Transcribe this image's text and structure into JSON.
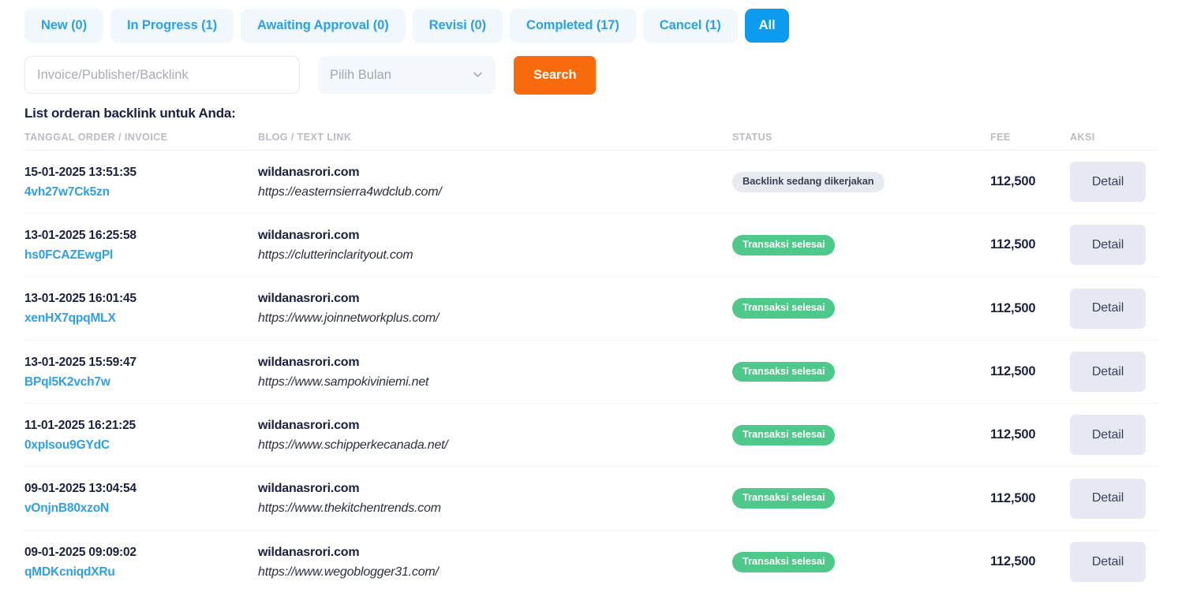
{
  "tabs": [
    {
      "label": "New (0)",
      "active": false,
      "name": "tab-new"
    },
    {
      "label": "In Progress (1)",
      "active": false,
      "name": "tab-in-progress"
    },
    {
      "label": "Awaiting Approval (0)",
      "active": false,
      "name": "tab-awaiting-approval"
    },
    {
      "label": "Revisi (0)",
      "active": false,
      "name": "tab-revisi"
    },
    {
      "label": "Completed (17)",
      "active": false,
      "name": "tab-completed"
    },
    {
      "label": "Cancel (1)",
      "active": false,
      "name": "tab-cancel"
    },
    {
      "label": "All",
      "active": true,
      "name": "tab-all"
    }
  ],
  "filters": {
    "search_placeholder": "Invoice/Publisher/Backlink",
    "search_value": "",
    "month_selected": "Pilih Bulan",
    "month_options": [
      "Pilih Bulan"
    ],
    "search_button": "Search"
  },
  "list_title": "List orderan backlink untuk Anda:",
  "table": {
    "headers": {
      "date": "TANGGAL ORDER / INVOICE",
      "blog": "BLOG / TEXT LINK",
      "status": "STATUS",
      "fee": "FEE",
      "aksi": "AKSI"
    },
    "detail_label": "Detail",
    "rows": [
      {
        "order_date": "15-01-2025 13:51:35",
        "invoice": "4vh27w7Ck5zn",
        "blog": "wildanasrori.com",
        "text_link": "https://easternsierra4wdclub.com/",
        "status": "Backlink sedang dikerjakan",
        "status_type": "progress",
        "fee": "112,500"
      },
      {
        "order_date": "13-01-2025 16:25:58",
        "invoice": "hs0FCAZEwgPl",
        "blog": "wildanasrori.com",
        "text_link": "https://clutterinclarityout.com",
        "status": "Transaksi selesai",
        "status_type": "done",
        "fee": "112,500"
      },
      {
        "order_date": "13-01-2025 16:01:45",
        "invoice": "xenHX7qpqMLX",
        "blog": "wildanasrori.com",
        "text_link": "https://www.joinnetworkplus.com/",
        "status": "Transaksi selesai",
        "status_type": "done",
        "fee": "112,500"
      },
      {
        "order_date": "13-01-2025 15:59:47",
        "invoice": "BPql5K2vch7w",
        "blog": "wildanasrori.com",
        "text_link": "https://www.sampokiviniemi.net",
        "status": "Transaksi selesai",
        "status_type": "done",
        "fee": "112,500"
      },
      {
        "order_date": "11-01-2025 16:21:25",
        "invoice": "0xpIsou9GYdC",
        "blog": "wildanasrori.com",
        "text_link": "https://www.schipperkecanada.net/",
        "status": "Transaksi selesai",
        "status_type": "done",
        "fee": "112,500"
      },
      {
        "order_date": "09-01-2025 13:04:54",
        "invoice": "vOnjnB80xzoN",
        "blog": "wildanasrori.com",
        "text_link": "https://www.thekitchentrends.com",
        "status": "Transaksi selesai",
        "status_type": "done",
        "fee": "112,500"
      },
      {
        "order_date": "09-01-2025 09:09:02",
        "invoice": "qMDKcniqdXRu",
        "blog": "wildanasrori.com",
        "text_link": "https://www.wegoblogger31.com/",
        "status": "Transaksi selesai",
        "status_type": "done",
        "fee": "112,500"
      }
    ]
  },
  "colors": {
    "accent_blue": "#0d9bf0",
    "tab_bg": "#f0f8fe",
    "search_orange": "#f96a0d",
    "status_green": "#4ec98a",
    "status_gray": "#e7eaf1",
    "detail_gray": "#e6e9f2",
    "text_dark": "#1b2141"
  }
}
